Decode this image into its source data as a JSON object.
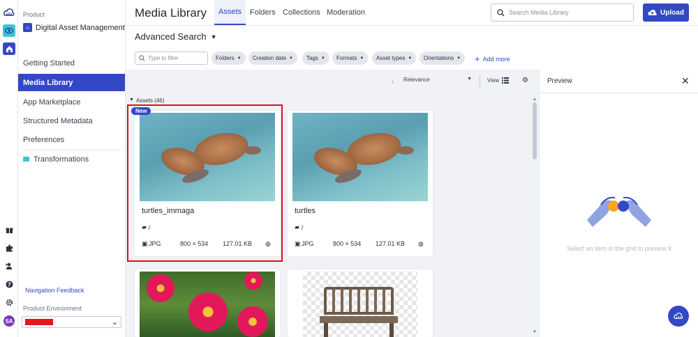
{
  "sidebar": {
    "product_label": "Product",
    "product_name": "Digital Asset Management",
    "items": [
      {
        "label": "Getting Started"
      },
      {
        "label": "Media Library"
      },
      {
        "label": "App Marketplace"
      },
      {
        "label": "Structured Metadata"
      },
      {
        "label": "Preferences"
      },
      {
        "label": "Transformations"
      }
    ],
    "nav_feedback": "Navigation Feedback",
    "env_label": "Product Environment",
    "avatar_initials": "SA"
  },
  "header": {
    "title": "Media Library",
    "tabs": [
      {
        "label": "Assets"
      },
      {
        "label": "Folders"
      },
      {
        "label": "Collections"
      },
      {
        "label": "Moderation"
      }
    ],
    "search_placeholder": "Search Media Library",
    "upload_label": "Upload"
  },
  "search_bar": {
    "title": "Advanced Search",
    "filter_placeholder": "Type to filter",
    "chips": [
      "Folders",
      "Creation date",
      "Tags",
      "Formats",
      "Asset types",
      "Orientations"
    ],
    "add_more": "Add more"
  },
  "grid": {
    "sort_label": "Relevance",
    "view_label": "View",
    "assets_header": "Assets (46)",
    "new_badge": "New",
    "cards": [
      {
        "name": "turtles_immaga",
        "folder": "/",
        "format": "JPG",
        "dimensions": "800 × 534",
        "size": "127.01 KB"
      },
      {
        "name": "turtles",
        "folder": "/",
        "format": "JPG",
        "dimensions": "800 × 534",
        "size": "127.01 KB"
      }
    ]
  },
  "preview": {
    "title": "Preview",
    "hint": "Select an item in the grid to preview it"
  },
  "colors": {
    "accent": "#3448c5",
    "highlight": "#d2141c",
    "env_redacted": "#e8141c"
  },
  "icons": [
    "cloud-logo-icon",
    "eye-icon",
    "home-icon",
    "gift-icon",
    "puzzle-icon",
    "user-plus-icon",
    "help-icon",
    "gear-icon",
    "search-icon",
    "cloud-upload-icon",
    "folder-icon",
    "image-icon",
    "globe-icon",
    "close-icon",
    "list-view-icon"
  ]
}
